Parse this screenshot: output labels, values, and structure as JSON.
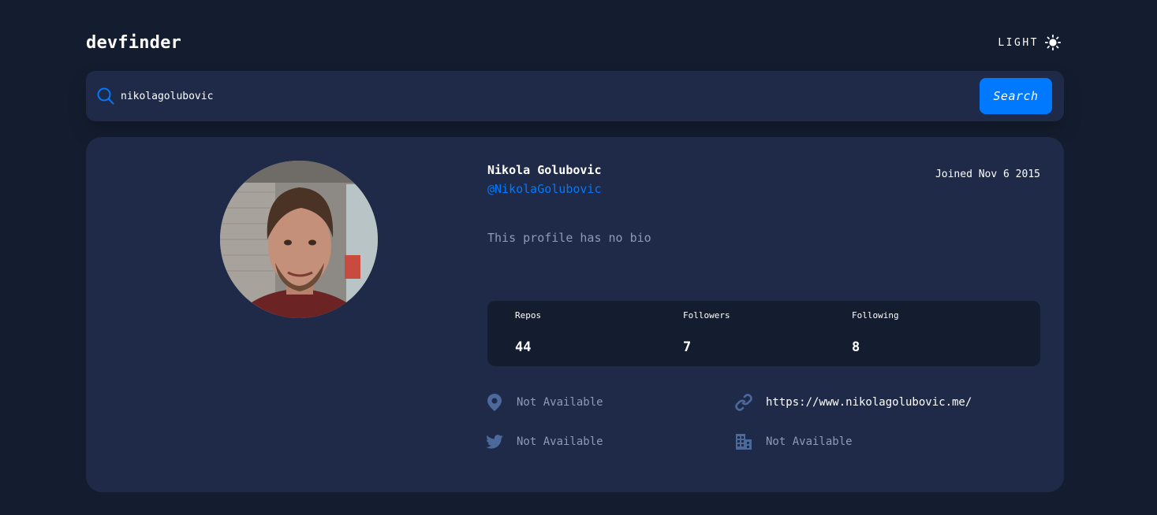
{
  "header": {
    "logo": "devfinder",
    "theme_label": "LIGHT"
  },
  "search": {
    "value": "nikolagolubovic",
    "button_label": "Search"
  },
  "profile": {
    "name": "Nikola Golubovic",
    "login": "@NikolaGolubovic",
    "joined": "Joined Nov 6 2015",
    "bio": "This profile has no bio",
    "stats": [
      {
        "label": "Repos",
        "value": "44"
      },
      {
        "label": "Followers",
        "value": "7"
      },
      {
        "label": "Following",
        "value": "8"
      }
    ],
    "links": {
      "location": "Not Available",
      "blog": "https://www.nikolagolubovic.me/",
      "twitter": "Not Available",
      "company": "Not Available"
    }
  },
  "colors": {
    "background": "#141d2f",
    "card": "#1e2a47",
    "accent": "#0079ff",
    "muted_text": "#8c9bb8",
    "unavailable_icon": "#4b6a9b"
  },
  "icons": {
    "theme": "sun-icon",
    "search": "search-icon",
    "location": "location-pin-icon",
    "blog": "link-icon",
    "twitter": "twitter-icon",
    "company": "building-icon"
  }
}
